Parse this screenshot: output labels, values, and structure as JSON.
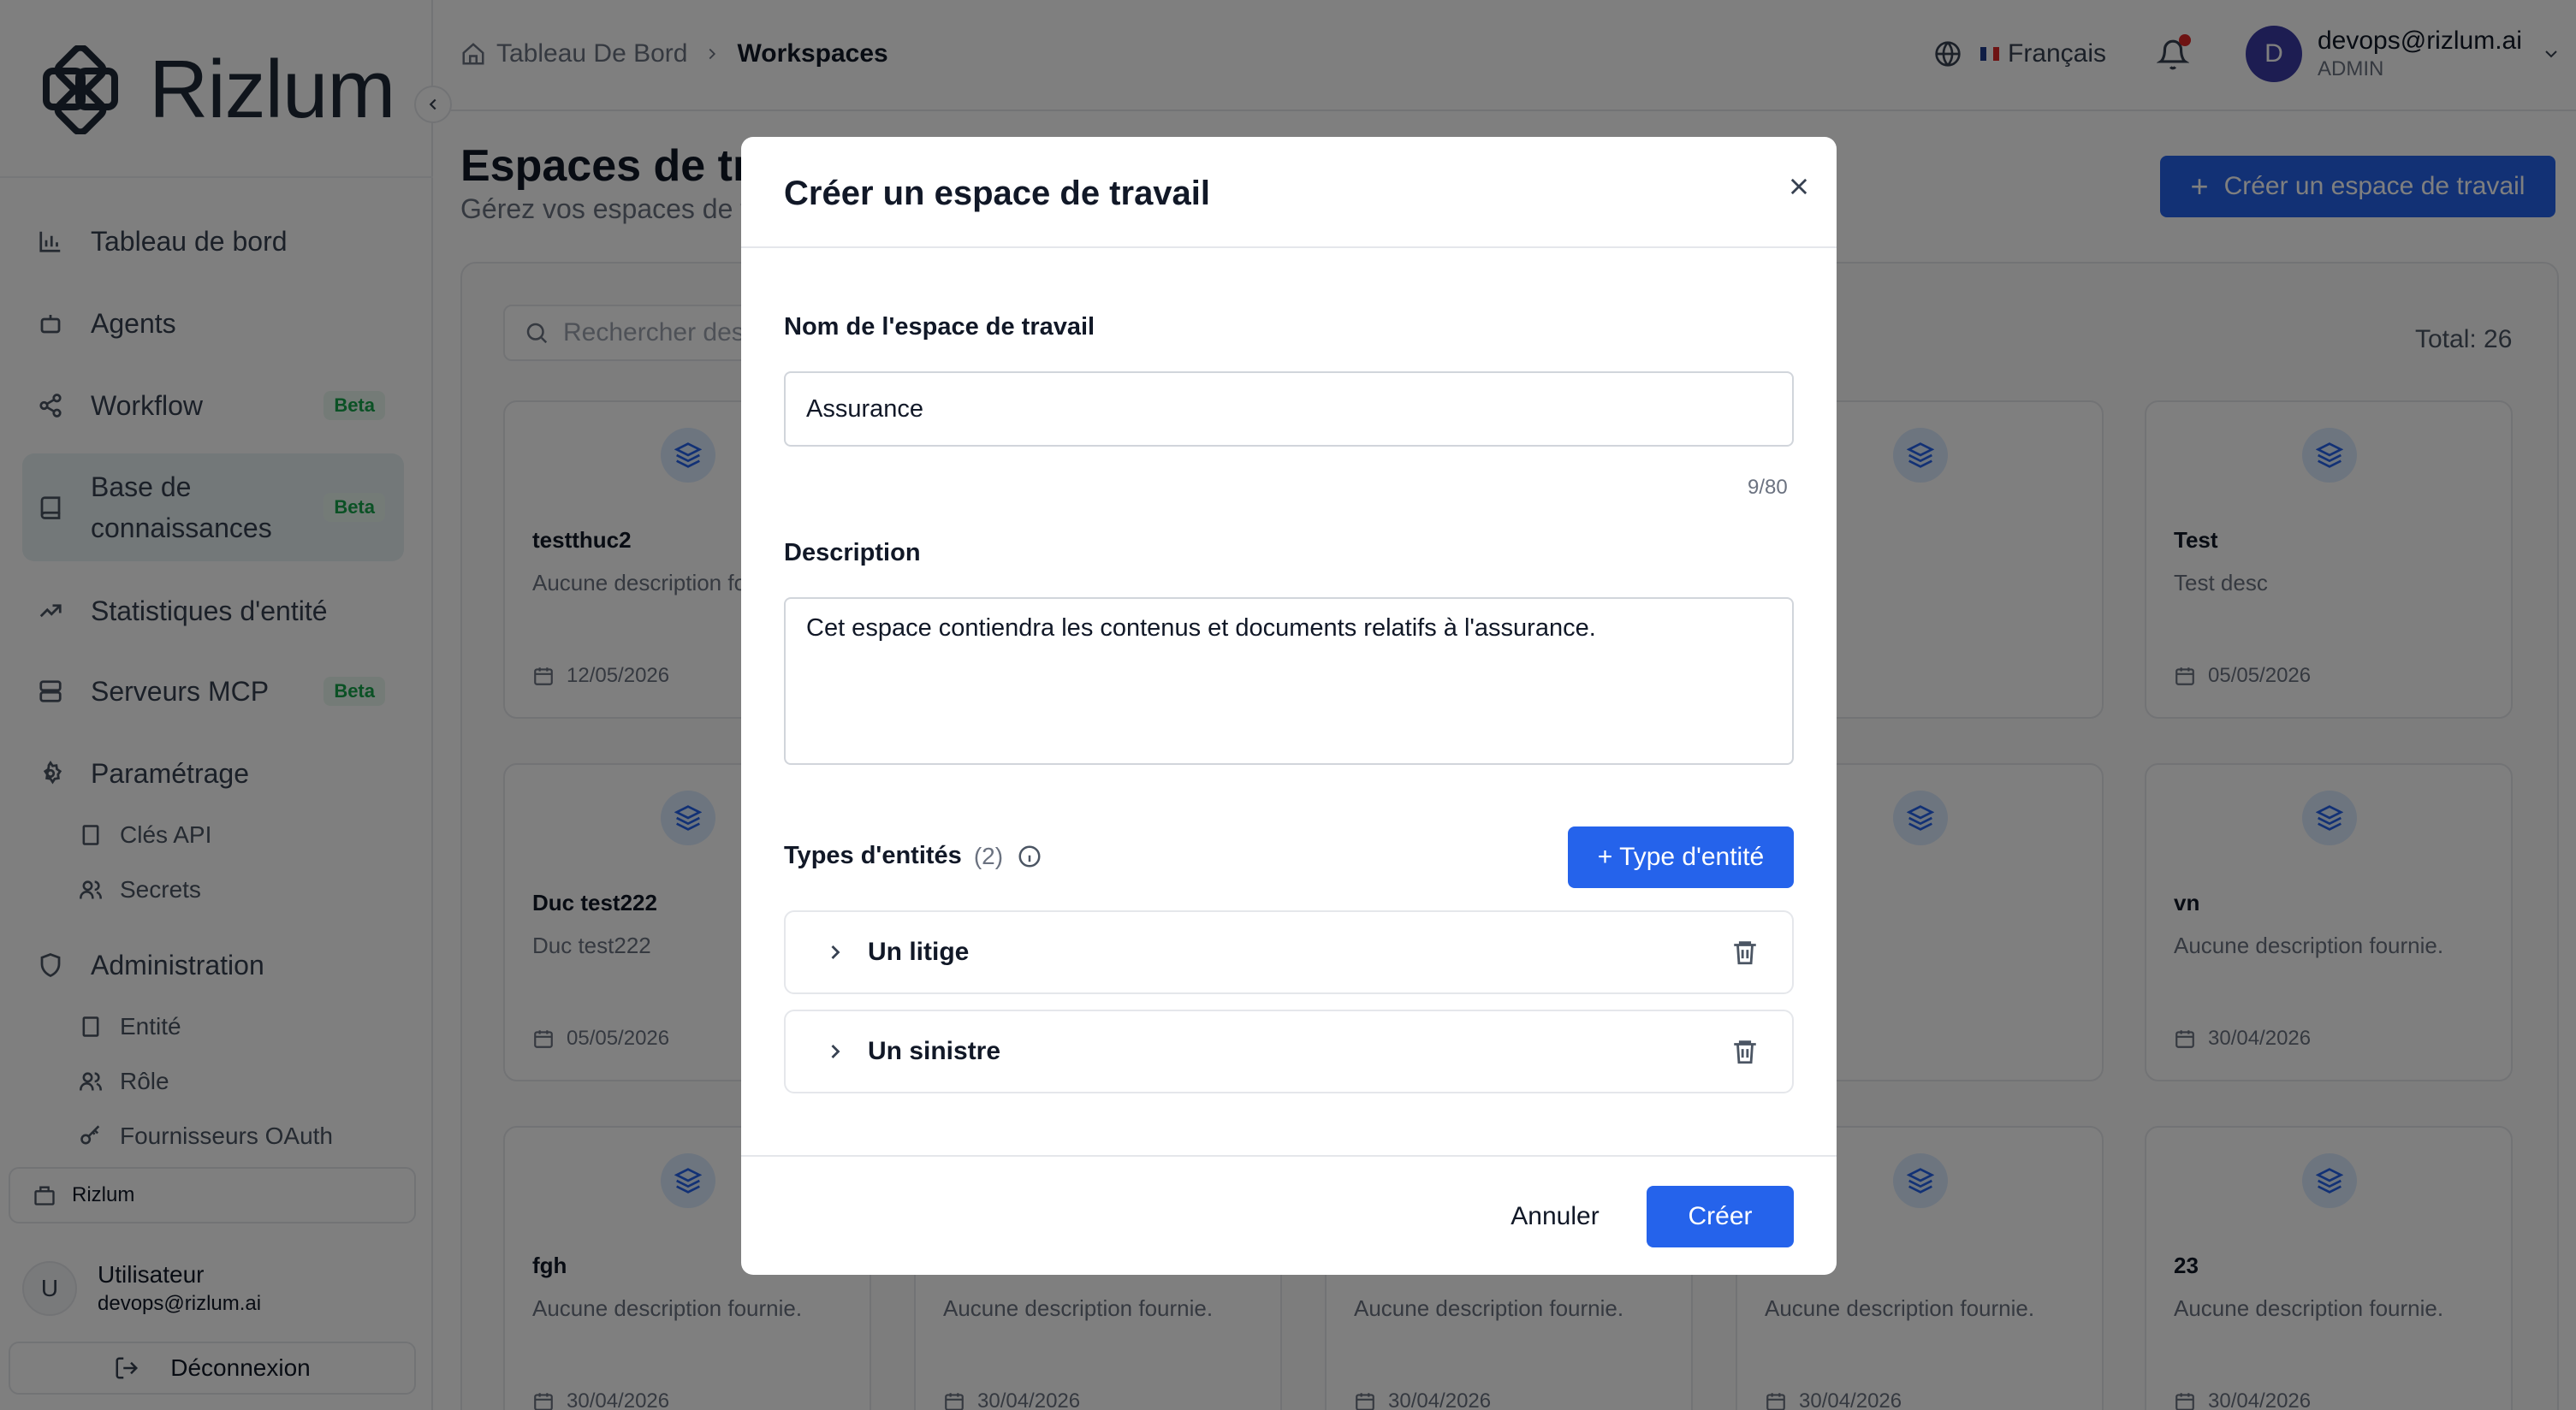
{
  "app": {
    "name": "Rizlum"
  },
  "sidebar": {
    "items": [
      {
        "label": "Tableau de bord",
        "icon": "bar-chart-icon"
      },
      {
        "label": "Agents",
        "icon": "bot-icon"
      },
      {
        "label": "Workflow",
        "icon": "share-nodes-icon",
        "badge": "Beta"
      },
      {
        "label": "Base de connaissances",
        "icon": "book-icon",
        "badge": "Beta",
        "active": true
      },
      {
        "label": "Statistiques d'entité",
        "icon": "trending-up-icon"
      },
      {
        "label": "Serveurs MCP",
        "icon": "server-icon",
        "badge": "Beta"
      },
      {
        "label": "Paramétrage",
        "icon": "gear-icon"
      }
    ],
    "settings_sub": [
      {
        "label": "Clés API",
        "icon": "building-icon"
      },
      {
        "label": "Secrets",
        "icon": "users-icon"
      }
    ],
    "admin_label": "Administration",
    "admin_sub": [
      {
        "label": "Entité",
        "icon": "building-icon"
      },
      {
        "label": "Rôle",
        "icon": "users-icon"
      },
      {
        "label": "Fournisseurs OAuth",
        "icon": "key-icon"
      }
    ],
    "org": "Rizlum",
    "user": {
      "initial": "U",
      "name": "Utilisateur",
      "email": "devops@rizlum.ai"
    },
    "logout": "Déconnexion"
  },
  "topbar": {
    "breadcrumb": [
      "Tableau De Bord",
      "Workspaces"
    ],
    "language": "Français",
    "account": {
      "initial": "D",
      "email": "devops@rizlum.ai",
      "role": "ADMIN"
    }
  },
  "page": {
    "title": "Espaces de travail",
    "subtitle": "Gérez vos espaces de travail",
    "create_button": "Créer un espace de travail",
    "search_placeholder": "Rechercher des espaces de travail",
    "total": "Total: 26"
  },
  "cards": [
    {
      "title": "testthuc2",
      "desc": "Aucune description fournie.",
      "date": "12/05/2026"
    },
    {
      "title": "Test",
      "desc": "Test desc",
      "date": "05/05/2026"
    },
    {
      "title": "Duc test222",
      "desc": "Duc test222",
      "date": "05/05/2026"
    },
    {
      "title": "vn",
      "desc": "Aucune description fournie.",
      "date": "30/04/2026"
    },
    {
      "title": "fgh",
      "desc": "Aucune description fournie.",
      "date": "30/04/2026"
    },
    {
      "title": "23",
      "desc": "Aucune description fournie.",
      "date": "30/04/2026"
    }
  ],
  "modal": {
    "title": "Créer un espace de travail",
    "name_label": "Nom de l'espace de travail",
    "name_value": "Assurance",
    "name_counter": "9/80",
    "description_label": "Description",
    "description_value": "Cet espace contiendra les contenus et documents relatifs à l'assurance.",
    "types_label": "Types d'entités",
    "types_count": "(2)",
    "add_type_button": "+ Type d'entité",
    "entity_types": [
      "Un litige",
      "Un sinistre"
    ],
    "cancel": "Annuler",
    "submit": "Créer"
  },
  "colors": {
    "primary": "#2563eb",
    "beta_bg": "#e8f7ee",
    "beta_text": "#16a34a",
    "overlay": "rgba(0,0,0,0.5)"
  }
}
